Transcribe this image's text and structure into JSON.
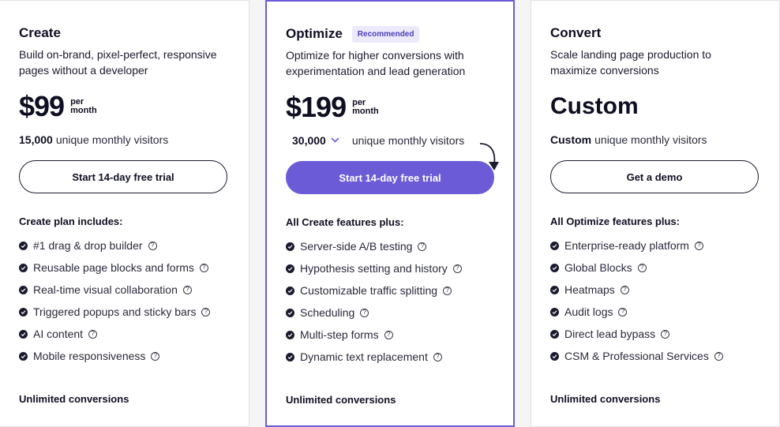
{
  "plans": [
    {
      "name": "Create",
      "description": "Build on-brand, pixel-perfect, responsive pages without a developer",
      "price": "$99",
      "per": "per",
      "month": "month",
      "visitors_bold": "15,000",
      "visitors_text": "unique monthly visitors",
      "button": "Start 14-day free trial",
      "includes_title": "Create plan includes:",
      "features": [
        "#1 drag & drop builder",
        "Reusable page blocks and forms",
        "Real-time visual collaboration",
        "Triggered popups and sticky bars",
        "AI content",
        "Mobile responsiveness"
      ],
      "conversions": "Unlimited conversions"
    },
    {
      "name": "Optimize",
      "badge": "Recommended",
      "description": "Optimize for higher conversions with experimentation and lead generation",
      "price": "$199",
      "per": "per",
      "month": "month",
      "visitors_select": "30,000",
      "visitors_text": "unique monthly visitors",
      "button": "Start 14-day free trial",
      "includes_title": "All Create features plus:",
      "features": [
        "Server-side A/B testing",
        "Hypothesis setting and history",
        "Customizable traffic splitting",
        "Scheduling",
        "Multi-step forms",
        "Dynamic text replacement"
      ],
      "conversions": "Unlimited conversions"
    },
    {
      "name": "Convert",
      "description": "Scale landing page production to maximize conversions",
      "price": "Custom",
      "visitors_bold": "Custom",
      "visitors_text": "unique monthly visitors",
      "button": "Get a demo",
      "includes_title": "All Optimize features plus:",
      "features": [
        "Enterprise-ready platform",
        "Global Blocks",
        "Heatmaps",
        "Audit logs",
        "Direct lead bypass",
        "CSM & Professional Services"
      ],
      "conversions": "Unlimited conversions"
    }
  ],
  "colors": {
    "accent": "#6b5bd6",
    "badge_bg": "#ece9fb",
    "text": "#1b1b2f"
  },
  "icons": {
    "check": "check-circle-icon",
    "help": "help-circle-icon",
    "chevron": "chevron-down-icon",
    "arrow": "curved-arrow-icon"
  }
}
